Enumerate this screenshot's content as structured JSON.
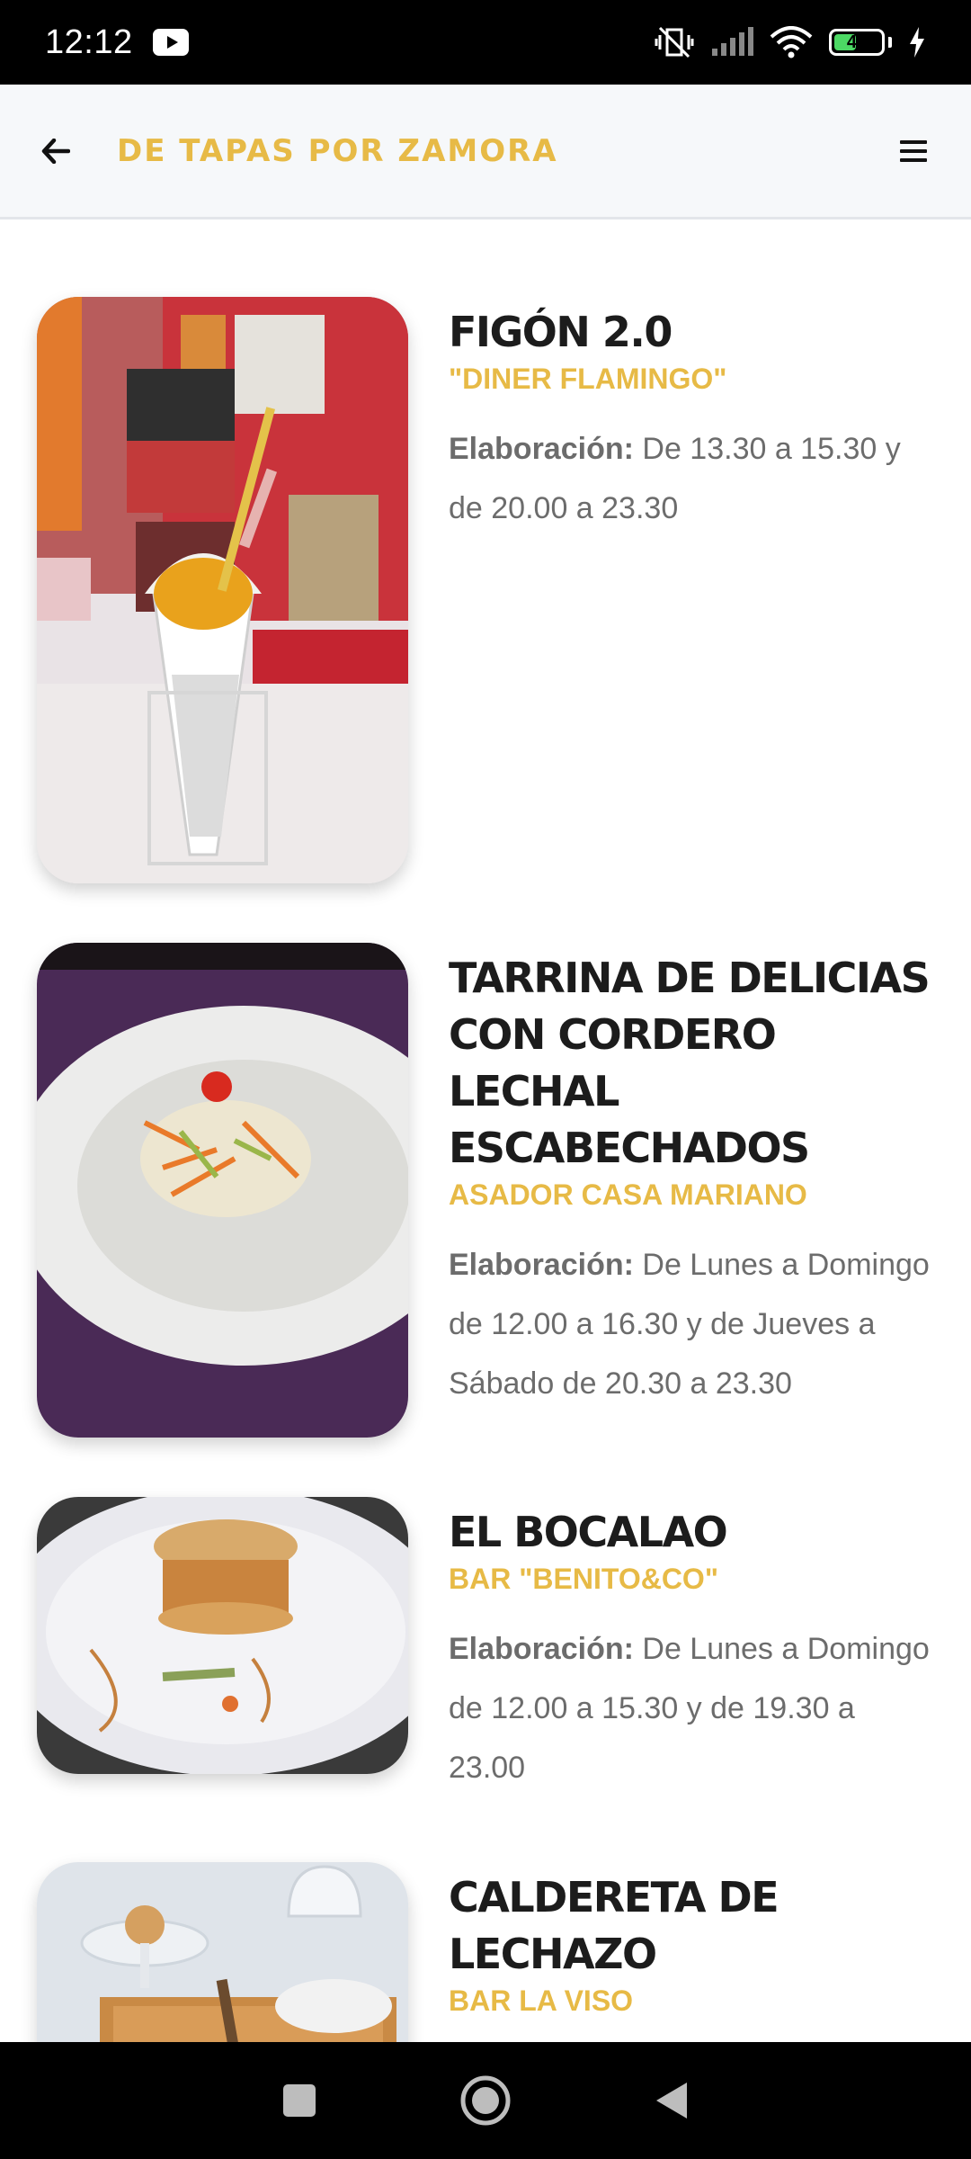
{
  "status_bar": {
    "time": "12:12",
    "battery_level": "48",
    "battery_fraction": 0.48,
    "icons": [
      "youtube-icon",
      "vibrate-off-icon",
      "signal-icon",
      "wifi-icon",
      "battery-icon",
      "charging-icon"
    ]
  },
  "app_bar": {
    "title": "DE TAPAS POR ZAMORA",
    "back_icon": "arrow-left-icon",
    "menu_icon": "hamburger-menu-icon"
  },
  "tapas": [
    {
      "name": "FIGÓN 2.0",
      "venue": "\"DINER FLAMINGO\"",
      "hours_label": "Elaboración:",
      "hours": "De 13.30 a 15.30 y de 20.00 a 23.30",
      "image": "tapa-cone-photo"
    },
    {
      "name": "TARRINA DE DELICIAS CON CORDERO LECHAL ESCABECHADOS",
      "venue": "ASADOR CASA MARIANO",
      "hours_label": "Elaboración:",
      "hours": "De Lunes a Domingo de 12.00 a 16.30 y de Jueves a Sábado de 20.30 a 23.30",
      "image": "tapa-plate-photo"
    },
    {
      "name": "EL BOCALAO",
      "venue": "BAR \"BENITO&CO\"",
      "hours_label": "Elaboración:",
      "hours": "De Lunes a Domingo de 12.00 a 15.30 y de 19.30 a 23.00",
      "image": "tapa-sandwich-photo"
    },
    {
      "name": "CALDERETA DE LECHAZO",
      "venue": "BAR LA VISO",
      "hours_label": "",
      "hours": "",
      "image": "tapa-tray-photo"
    }
  ],
  "nav_bar": {
    "icons": [
      "recents-square-icon",
      "home-circle-icon",
      "back-triangle-icon"
    ]
  },
  "colors": {
    "accent": "#e7ba46",
    "title_text": "#1c1c1c",
    "body_text": "#6c6c6c",
    "app_bar_bg": "#f6f8fa",
    "battery_green": "#4cd964"
  }
}
